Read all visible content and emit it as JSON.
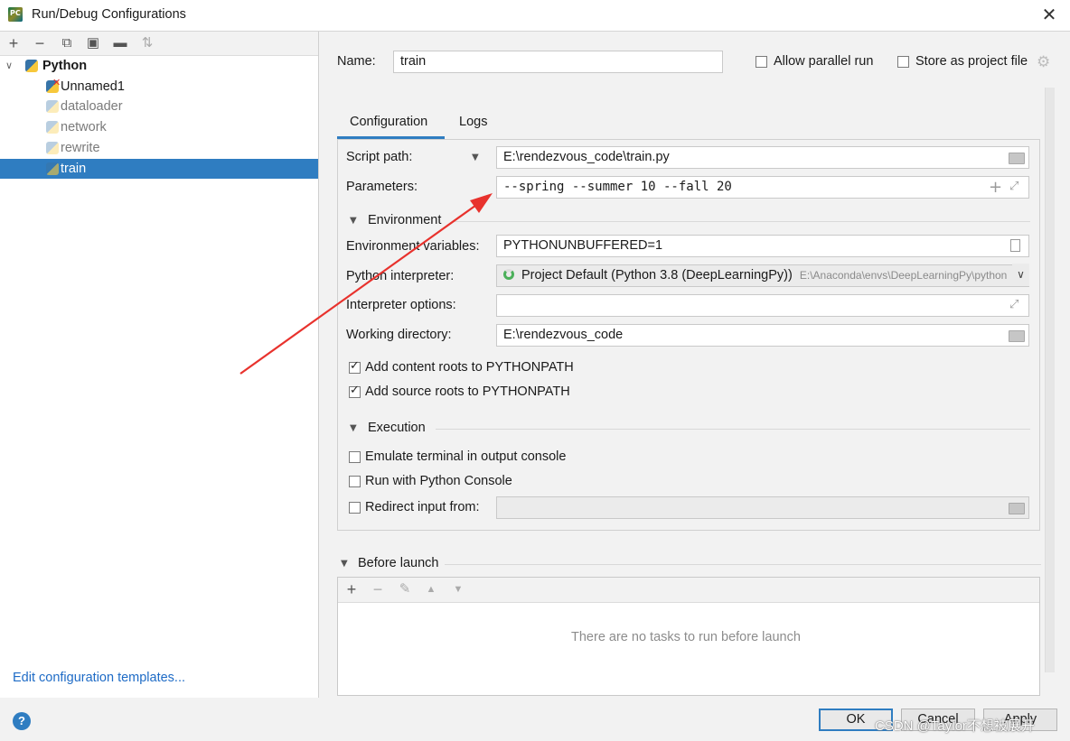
{
  "window": {
    "title": "Run/Debug Configurations",
    "app_icon_text": "PC"
  },
  "left_panel": {
    "toolbar": [
      "add-icon",
      "remove-icon",
      "copy-icon",
      "save-icon",
      "folder-add-icon",
      "sort-icon"
    ],
    "tree": {
      "root": "Python",
      "items": [
        "Unnamed1",
        "dataloader",
        "network",
        "rewrite",
        "train"
      ],
      "selected": "train"
    },
    "edit_templates": "Edit configuration templates..."
  },
  "header": {
    "name_label": "Name:",
    "name_value": "train",
    "allow_parallel": "Allow parallel run",
    "store_project": "Store as project file"
  },
  "tabs": [
    "Configuration",
    "Logs"
  ],
  "config": {
    "script_path_label": "Script path:",
    "script_path": "E:\\rendezvous_code\\train.py",
    "parameters_label": "Parameters:",
    "parameters": "--spring --summer 10 --fall 20",
    "environment_section": "Environment",
    "env_vars_label": "Environment variables:",
    "env_vars": "PYTHONUNBUFFERED=1",
    "interpreter_label": "Python interpreter:",
    "interpreter": "Project Default (Python 3.8 (DeepLearningPy))",
    "interpreter_path": "E:\\Anaconda\\envs\\DeepLearningPy\\python",
    "interp_options_label": "Interpreter options:",
    "working_dir_label": "Working directory:",
    "working_dir": "E:\\rendezvous_code",
    "add_content_roots": "Add content roots to PYTHONPATH",
    "add_source_roots": "Add source roots to PYTHONPATH",
    "execution_section": "Execution",
    "emulate_terminal": "Emulate terminal in output console",
    "run_python_console": "Run with Python Console",
    "redirect_input": "Redirect input from:"
  },
  "before_launch": {
    "title": "Before launch",
    "empty_text": "There are no tasks to run before launch"
  },
  "buttons": {
    "ok": "OK",
    "cancel": "Cancel",
    "apply": "Apply"
  },
  "watermark": "CSDN @Taylor不想被展开",
  "colors": {
    "accent": "#2f7dc1",
    "selection": "#2f7dc1",
    "arrow": "#e8322d"
  }
}
